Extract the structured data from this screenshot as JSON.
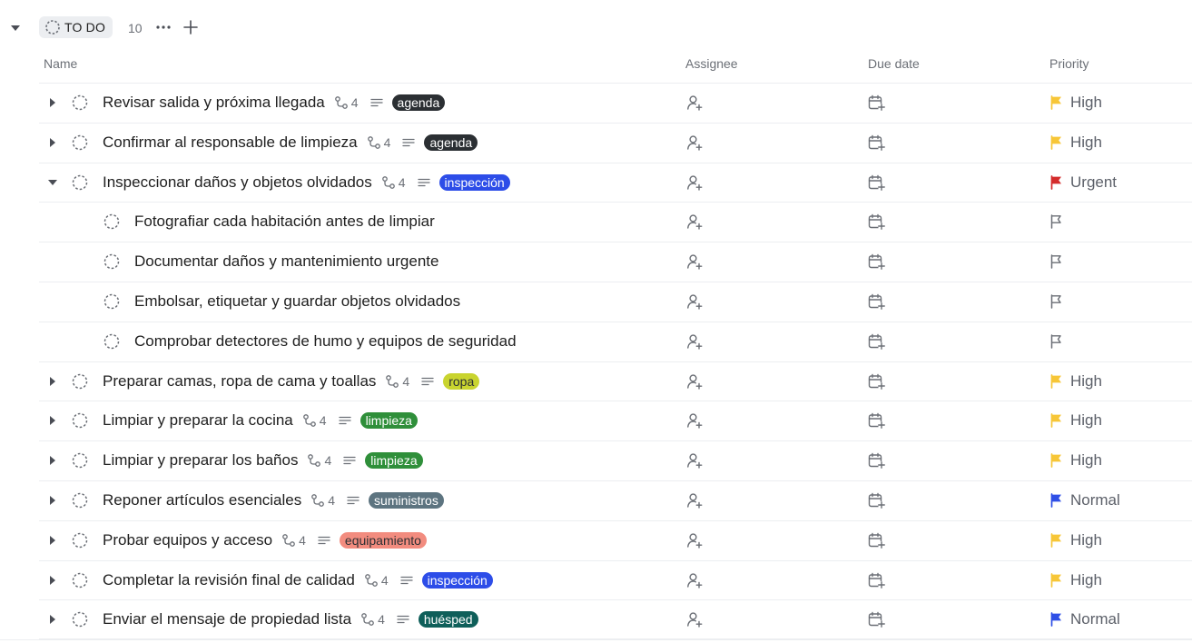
{
  "group": {
    "status_label": "TO DO",
    "count": "10"
  },
  "columns": {
    "name": "Name",
    "assignee": "Assignee",
    "due_date": "Due date",
    "priority": "Priority"
  },
  "colors": {
    "flag_high": "#f7c637",
    "flag_urgent": "#d42c2c",
    "flag_normal": "#2f4fe6",
    "flag_none": "#6b6f76"
  },
  "tasks": [
    {
      "name": "Revisar salida y próxima llegada",
      "subtasks": "4",
      "tag": "agenda",
      "tag_color": "#2b2f33",
      "priority": "High",
      "flag": "high",
      "subtask": false,
      "expanded": false
    },
    {
      "name": "Confirmar al responsable de limpieza",
      "subtasks": "4",
      "tag": "agenda",
      "tag_color": "#2b2f33",
      "priority": "High",
      "flag": "high",
      "subtask": false,
      "expanded": false
    },
    {
      "name": "Inspeccionar daños y objetos olvidados",
      "subtasks": "4",
      "tag": "inspección",
      "tag_color": "#2d4de8",
      "priority": "Urgent",
      "flag": "urgent",
      "subtask": false,
      "expanded": true
    },
    {
      "name": "Fotografiar cada habitación antes de limpiar",
      "subtasks": "",
      "tag": "",
      "tag_color": "",
      "priority": "",
      "flag": "none",
      "subtask": true,
      "expanded": false
    },
    {
      "name": "Documentar daños y mantenimiento urgente",
      "subtasks": "",
      "tag": "",
      "tag_color": "",
      "priority": "",
      "flag": "none",
      "subtask": true,
      "expanded": false
    },
    {
      "name": "Embolsar, etiquetar y guardar objetos olvidados",
      "subtasks": "",
      "tag": "",
      "tag_color": "",
      "priority": "",
      "flag": "none",
      "subtask": true,
      "expanded": false
    },
    {
      "name": "Comprobar detectores de humo y equipos de seguridad",
      "subtasks": "",
      "tag": "",
      "tag_color": "",
      "priority": "",
      "flag": "none",
      "subtask": true,
      "expanded": false
    },
    {
      "name": "Preparar camas, ropa de cama y toallas",
      "subtasks": "4",
      "tag": "ropa",
      "tag_color": "#c9d42f",
      "tag_text": "#2b2f33",
      "priority": "High",
      "flag": "high",
      "subtask": false,
      "expanded": false
    },
    {
      "name": "Limpiar y preparar la cocina",
      "subtasks": "4",
      "tag": "limpieza",
      "tag_color": "#2f8f3a",
      "priority": "High",
      "flag": "high",
      "subtask": false,
      "expanded": false
    },
    {
      "name": "Limpiar y preparar los baños",
      "subtasks": "4",
      "tag": "limpieza",
      "tag_color": "#2f8f3a",
      "priority": "High",
      "flag": "high",
      "subtask": false,
      "expanded": false
    },
    {
      "name": "Reponer artículos esenciales",
      "subtasks": "4",
      "tag": "suministros",
      "tag_color": "#5d7480",
      "priority": "Normal",
      "flag": "normal",
      "subtask": false,
      "expanded": false
    },
    {
      "name": "Probar equipos y acceso",
      "subtasks": "4",
      "tag": "equipamiento",
      "tag_color": "#f28c7f",
      "tag_text": "#2b2f33",
      "priority": "High",
      "flag": "high",
      "subtask": false,
      "expanded": false
    },
    {
      "name": "Completar la revisión final de calidad",
      "subtasks": "4",
      "tag": "inspección",
      "tag_color": "#2d4de8",
      "priority": "High",
      "flag": "high",
      "subtask": false,
      "expanded": false
    },
    {
      "name": "Enviar el mensaje de propiedad lista",
      "subtasks": "4",
      "tag": "huésped",
      "tag_color": "#0f5f5a",
      "priority": "Normal",
      "flag": "normal",
      "subtask": false,
      "expanded": false
    }
  ]
}
